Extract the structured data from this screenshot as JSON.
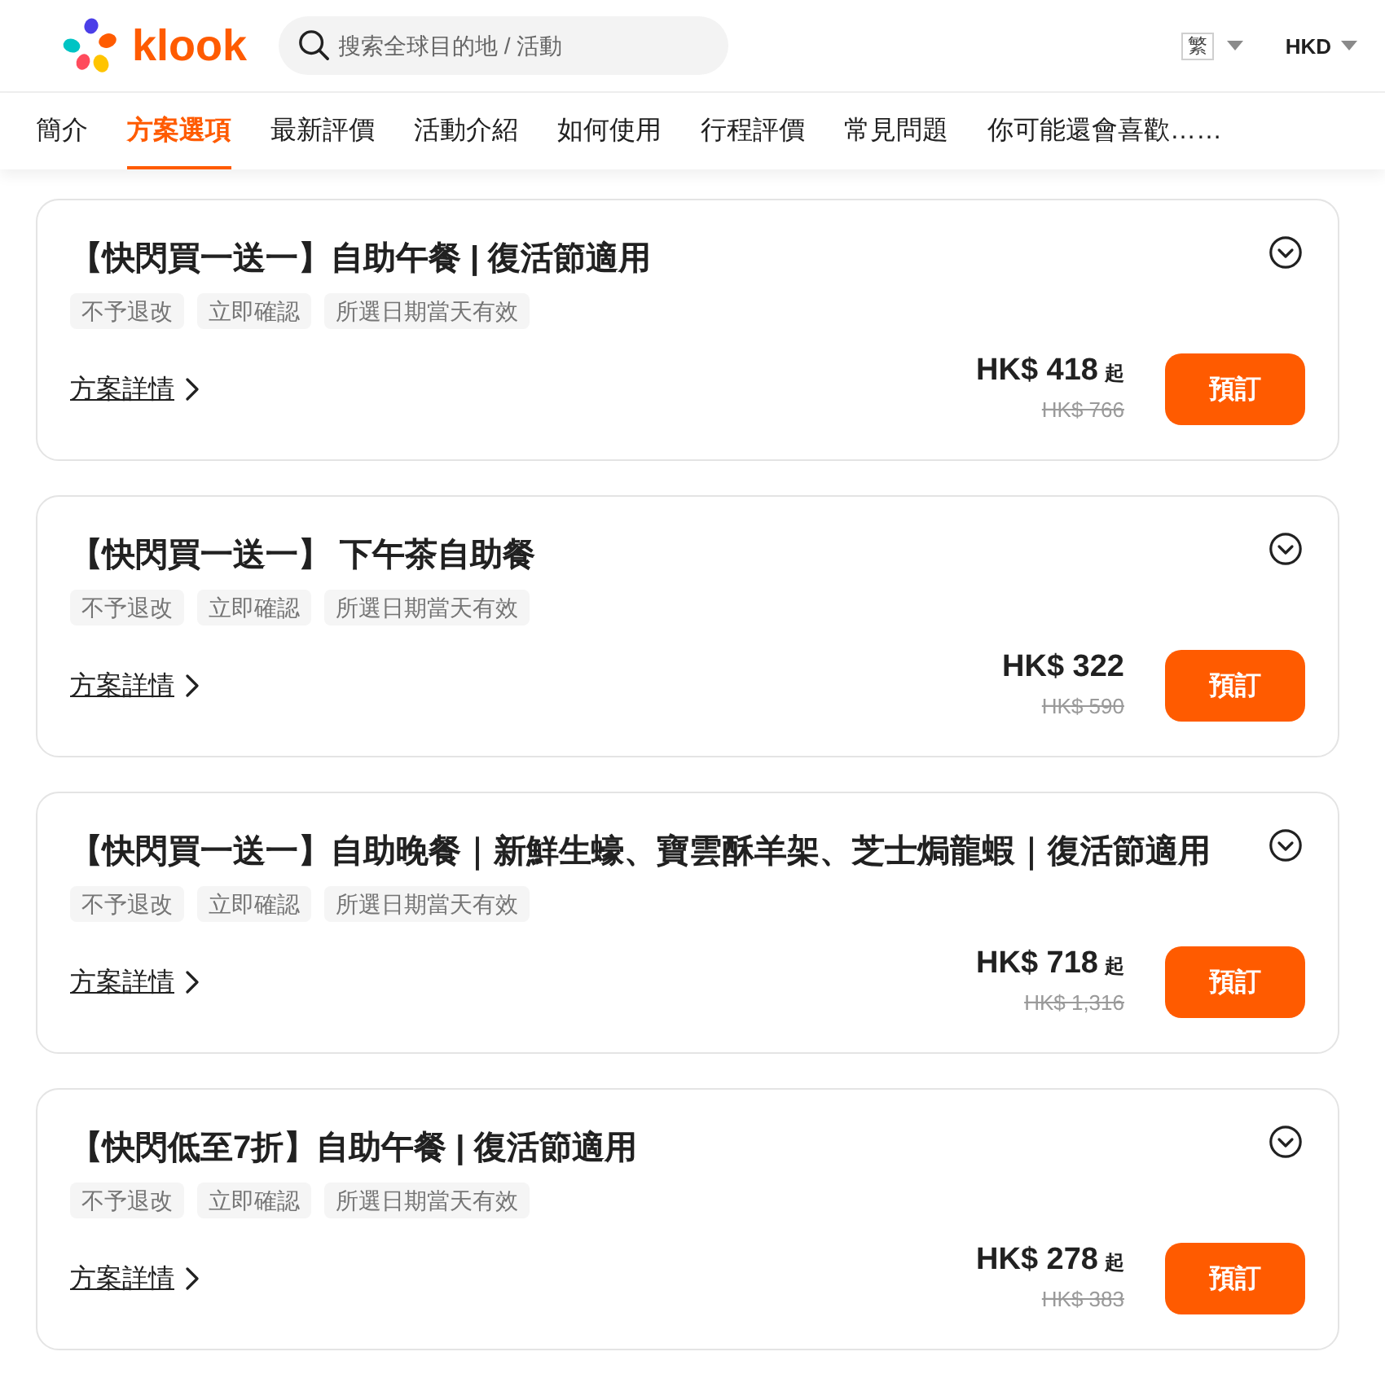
{
  "header": {
    "logo": {
      "text": "klook"
    },
    "search": {
      "placeholder": "搜索全球目的地 / 活動"
    },
    "language": "繁",
    "currency": "HKD"
  },
  "nav": {
    "tabs": [
      {
        "label": "簡介",
        "selected": false
      },
      {
        "label": "方案選項",
        "selected": true
      },
      {
        "label": "最新評價",
        "selected": false
      },
      {
        "label": "活動介紹",
        "selected": false
      },
      {
        "label": "如何使用",
        "selected": false
      },
      {
        "label": "行程評價",
        "selected": false
      },
      {
        "label": "常見問題",
        "selected": false
      },
      {
        "label": "你可能還會喜歡……",
        "selected": false
      }
    ]
  },
  "packages": [
    {
      "title": "【快閃買一送一】自助午餐 | 復活節適用",
      "expanded": false,
      "tags": [
        "不予退改",
        "立即確認",
        "所選日期當天有效"
      ],
      "details_link": "方案詳情",
      "price": "HK$ 418",
      "price_suffix": "起",
      "original_price": "HK$ 766",
      "button": "預訂"
    },
    {
      "title": "【快閃買一送一】 下午茶自助餐",
      "expanded": false,
      "tags": [
        "不予退改",
        "立即確認",
        "所選日期當天有效"
      ],
      "details_link": "方案詳情",
      "price": "HK$ 322",
      "original_price": "HK$ 590",
      "button": "預訂"
    },
    {
      "title": "【快閃買一送一】自助晚餐｜新鮮生蠔、寶雲酥羊架、芝士焗龍蝦｜復活節適用",
      "expanded": false,
      "tags": [
        "不予退改",
        "立即確認",
        "所選日期當天有效"
      ],
      "details_link": "方案詳情",
      "price": "HK$ 718",
      "price_suffix": "起",
      "original_price": "HK$ 1,316",
      "button": "預訂"
    },
    {
      "title": "【快閃低至7折】自助午餐 | 復活節適用",
      "expanded": false,
      "tags": [
        "不予退改",
        "立即確認",
        "所選日期當天有效"
      ],
      "details_link": "方案詳情",
      "price": "HK$ 278",
      "price_suffix": "起",
      "original_price": "HK$ 383",
      "button": "預訂"
    }
  ]
}
